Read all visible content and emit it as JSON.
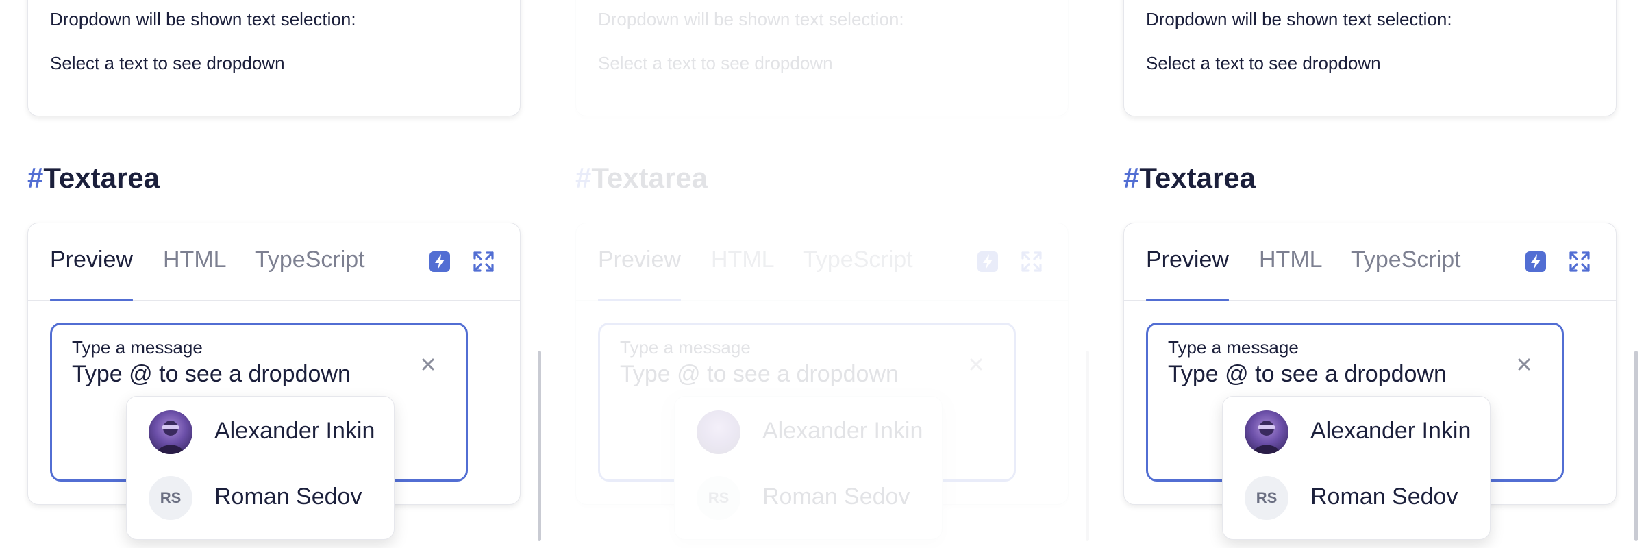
{
  "panels": [
    {
      "selection": {
        "line1": "Dropdown will be shown text selection:",
        "line2": "Select a text to see dropdown"
      },
      "heading": {
        "hash": "#",
        "title": "Textarea"
      },
      "tabs": [
        "Preview",
        "HTML",
        "TypeScript"
      ],
      "active_tab": "Preview",
      "textarea": {
        "label": "Type a message",
        "value": "Type @ to see a dropdown"
      },
      "dropdown": [
        {
          "name": "Alexander Inkin",
          "avatar": "photo"
        },
        {
          "name": "Roman Sedov",
          "initials": "RS"
        }
      ]
    },
    {
      "selection": {
        "line1": "Dropdown will be shown text selection:",
        "line2": "Select a text to see dropdown"
      },
      "heading": {
        "hash": "#",
        "title": "Textarea"
      },
      "tabs": [
        "Preview",
        "HTML",
        "TypeScript"
      ],
      "active_tab": "Preview",
      "textarea": {
        "label": "Type a message",
        "value": "Type @ to see a dropdown"
      },
      "dropdown": [
        {
          "name": "Alexander Inkin",
          "avatar": "photo"
        },
        {
          "name": "Roman Sedov",
          "initials": "RS"
        }
      ]
    },
    {
      "selection": {
        "line1": "Dropdown will be shown text selection:",
        "line2": "Select a text to see dropdown"
      },
      "heading": {
        "hash": "#",
        "title": "Textarea"
      },
      "tabs": [
        "Preview",
        "HTML",
        "TypeScript"
      ],
      "active_tab": "Preview",
      "textarea": {
        "label": "Type a message",
        "value": "Type @ to see a dropdown"
      },
      "dropdown": [
        {
          "name": "Alexander Inkin",
          "avatar": "photo"
        },
        {
          "name": "Roman Sedov",
          "initials": "RS"
        }
      ]
    }
  ],
  "icons": {
    "tool_1": "flash-icon",
    "tool_2": "expand-icon",
    "clear": "close-icon"
  },
  "colors": {
    "accent": "#526ed3",
    "text": "#1b1f3b",
    "muted": "#7d8091",
    "border": "#e6e7ec"
  }
}
